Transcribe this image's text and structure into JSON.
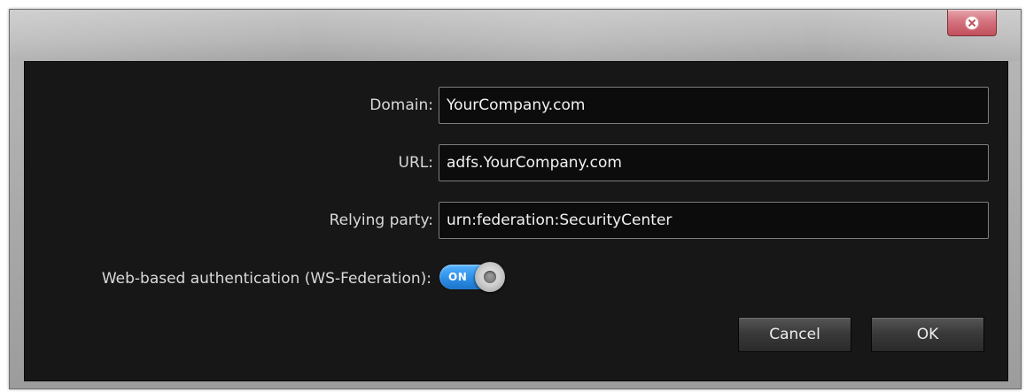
{
  "window": {
    "close_icon": "close-icon"
  },
  "form": {
    "domain": {
      "label": "Domain:",
      "value": "YourCompany.com"
    },
    "url": {
      "label": "URL:",
      "value": "adfs.YourCompany.com"
    },
    "relying_party": {
      "label": "Relying party:",
      "value": "urn:federation:SecurityCenter"
    },
    "web_auth": {
      "label": "Web-based authentication (WS-Federation):",
      "toggle_text": "ON",
      "state": true
    }
  },
  "buttons": {
    "cancel": "Cancel",
    "ok": "OK"
  },
  "colors": {
    "content_bg": "#171717",
    "toggle_on": "#2d8fe8",
    "close_button": "#d4737e"
  }
}
